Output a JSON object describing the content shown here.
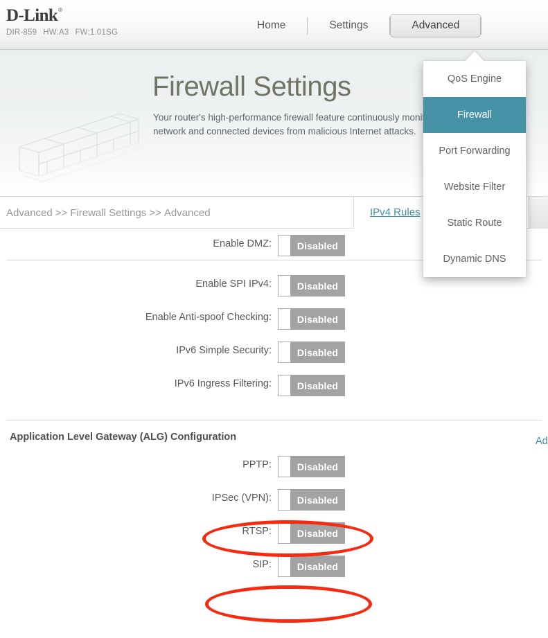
{
  "brand": {
    "logo": "D-Link",
    "registered": "®",
    "model": "DIR-859",
    "hardware": "HW:A3",
    "firmware": "FW:1.01SG"
  },
  "nav": {
    "items": [
      {
        "label": "Home",
        "active": false
      },
      {
        "label": "Settings",
        "active": false
      },
      {
        "label": "Advanced",
        "active": true
      }
    ]
  },
  "dropdown": {
    "items": [
      {
        "label": "QoS Engine",
        "selected": false
      },
      {
        "label": "Firewall",
        "selected": true
      },
      {
        "label": "Port Forwarding",
        "selected": false
      },
      {
        "label": "Website Filter",
        "selected": false
      },
      {
        "label": "Static Route",
        "selected": false
      },
      {
        "label": "Dynamic DNS",
        "selected": false
      }
    ],
    "highlight_color": "#4592a6"
  },
  "hero": {
    "title": "Firewall Settings",
    "description": "Your router's high-performance firewall feature continuously monitors and protects your network and connected devices from malicious Internet attacks.",
    "illustration": "brick-wall"
  },
  "breadcrumb": {
    "segments": [
      "Advanced",
      "Firewall Settings",
      "Advanced"
    ],
    "separator": ">>"
  },
  "tabs": {
    "ipv4_rules_label": "IPv4 Rules"
  },
  "form": {
    "dmz": {
      "label": "Enable DMZ:",
      "value": "Disabled"
    },
    "group_main": [
      {
        "label": "Enable SPI IPv4:",
        "value": "Disabled"
      },
      {
        "label": "Enable Anti-spoof Checking:",
        "value": "Disabled"
      },
      {
        "label": "IPv6 Simple Security:",
        "value": "Disabled"
      },
      {
        "label": "IPv6 Ingress Filtering:",
        "value": "Disabled"
      }
    ],
    "add_link": "Ad",
    "alg": {
      "section_title": "Application Level Gateway (ALG) Configuration",
      "rows": [
        {
          "label": "PPTP:",
          "value": "Disabled",
          "annotated": false
        },
        {
          "label": "IPSec (VPN):",
          "value": "Disabled",
          "annotated": true
        },
        {
          "label": "RTSP:",
          "value": "Disabled",
          "annotated": false
        },
        {
          "label": "SIP:",
          "value": "Disabled",
          "annotated": true
        }
      ]
    }
  },
  "annotations": {
    "color": "#f42a11",
    "shapes": [
      "ellipse-around-ipsec-vpn-row",
      "ellipse-around-sip-row"
    ]
  }
}
